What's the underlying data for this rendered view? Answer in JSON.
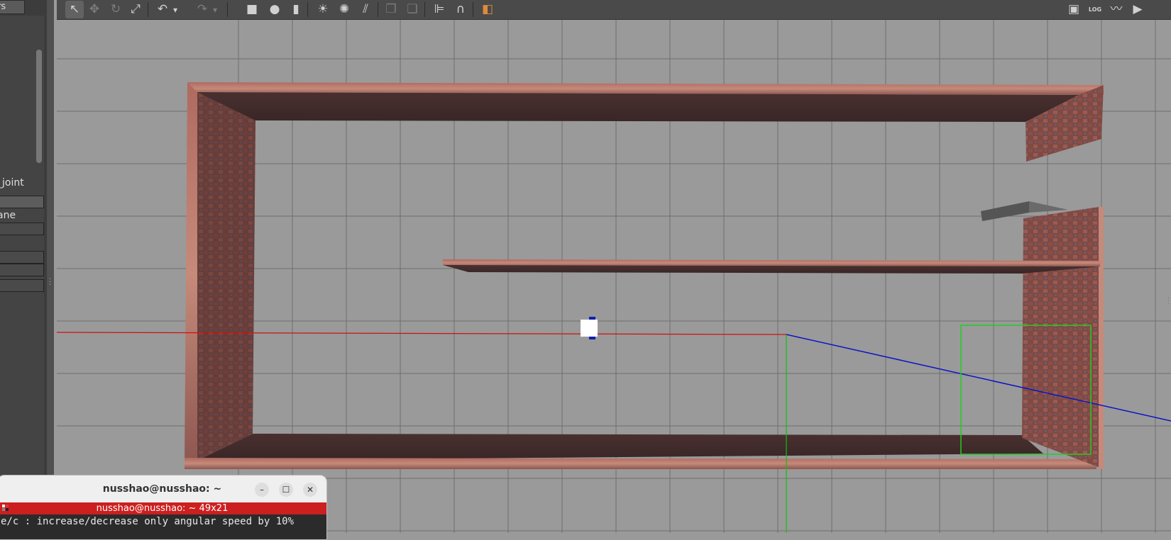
{
  "left_panel": {
    "tab_label": "ers",
    "tree_items": [
      "_joint",
      "ane"
    ]
  },
  "toolbar": {
    "tools": [
      {
        "name": "select-mode-icon",
        "glyph": "↖",
        "active": true
      },
      {
        "name": "translate-mode-icon",
        "glyph": "✥",
        "dim": true
      },
      {
        "name": "rotate-mode-icon",
        "glyph": "↻",
        "dim": true
      },
      {
        "name": "scale-mode-icon",
        "glyph": "⤢"
      },
      {
        "name": "undo-icon",
        "glyph": "↶"
      },
      {
        "name": "undo-dropdown-icon",
        "glyph": "▾"
      },
      {
        "name": "redo-icon",
        "glyph": "↷",
        "dim": true
      },
      {
        "name": "redo-dropdown-icon",
        "glyph": "▾",
        "dim": true
      },
      {
        "name": "box-shape-icon",
        "glyph": "■"
      },
      {
        "name": "sphere-shape-icon",
        "glyph": "●"
      },
      {
        "name": "cylinder-shape-icon",
        "glyph": "▮"
      },
      {
        "name": "point-light-icon",
        "glyph": "☀"
      },
      {
        "name": "spot-light-icon",
        "glyph": "✺"
      },
      {
        "name": "directional-light-icon",
        "glyph": "⫽"
      },
      {
        "name": "copy-icon",
        "glyph": "❐",
        "dim": true
      },
      {
        "name": "paste-icon",
        "glyph": "❏",
        "dim": true
      },
      {
        "name": "align-icon",
        "glyph": "⊫"
      },
      {
        "name": "snap-icon",
        "glyph": "∩"
      },
      {
        "name": "change-view-icon",
        "glyph": "◧",
        "color": "#e08a3c"
      },
      {
        "name": "screenshot-icon",
        "glyph": "▣"
      },
      {
        "name": "log-icon",
        "glyph": "LOG"
      },
      {
        "name": "plot-icon",
        "glyph": "〰"
      },
      {
        "name": "video-record-icon",
        "glyph": "▶"
      }
    ]
  },
  "terminal": {
    "title": "nusshao@nusshao: ~",
    "tab_title": "nusshao@nusshao: ~ 49x21",
    "line": "e/c : increase/decrease only angular speed by 10%",
    "minimize": "–",
    "maximize": "☐",
    "close": "✕"
  },
  "colors": {
    "viewport_bg": "#9a9a9a",
    "grid": "#6e6e6e",
    "wall_top": "#a8625a",
    "wall_inner": "#3e2b2b",
    "x_axis": "#d01010",
    "y_axis": "#10c010",
    "z_axis": "#0b14c8",
    "terminal_tab": "#cc1f1f"
  }
}
